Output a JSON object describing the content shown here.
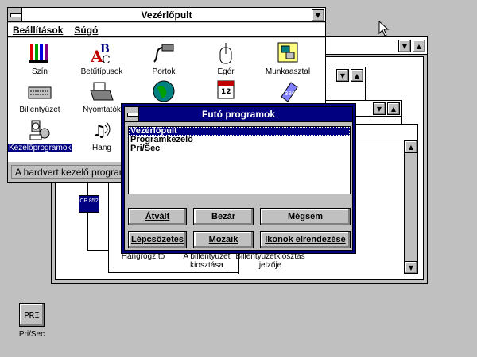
{
  "control_panel": {
    "title": "Vezérlőpult",
    "menu": [
      "Beállítások",
      "Súgó"
    ],
    "icons": [
      "Szín",
      "Betűtípusok",
      "Portok",
      "Egér",
      "Munkaasztal",
      "Billentyűzet",
      "Nyomtatók",
      "Nemzetközi",
      "Dátum/Idő",
      "386 Bővített",
      "Kezelőprogramok",
      "Hang"
    ],
    "status": "A hardvert kezelő programok"
  },
  "dialog": {
    "title": "Futó programok",
    "items": [
      "Vezérlőpult",
      "Programkezelő",
      "Pri/Sec"
    ],
    "buttons": {
      "switch": "Átvált",
      "close": "Bezár",
      "cancel": "Mégsem",
      "cascade": "Lépcsőzetes",
      "tile": "Mozaik",
      "arrange": "Ikonok elrendezése"
    }
  },
  "bg_window": {
    "labels": [
      "Hangrögzítő",
      "A billentyűzet kiosztása",
      "Billentyűzetkiosztás jelzője"
    ]
  },
  "cp_icon_label": "CP 852",
  "desktop": {
    "icon_text": "PRI",
    "icon_label": "Pri/Sec"
  },
  "colors": {
    "active_title": "#000080",
    "desktop": "#c0c0c0",
    "selection": "#000080"
  }
}
